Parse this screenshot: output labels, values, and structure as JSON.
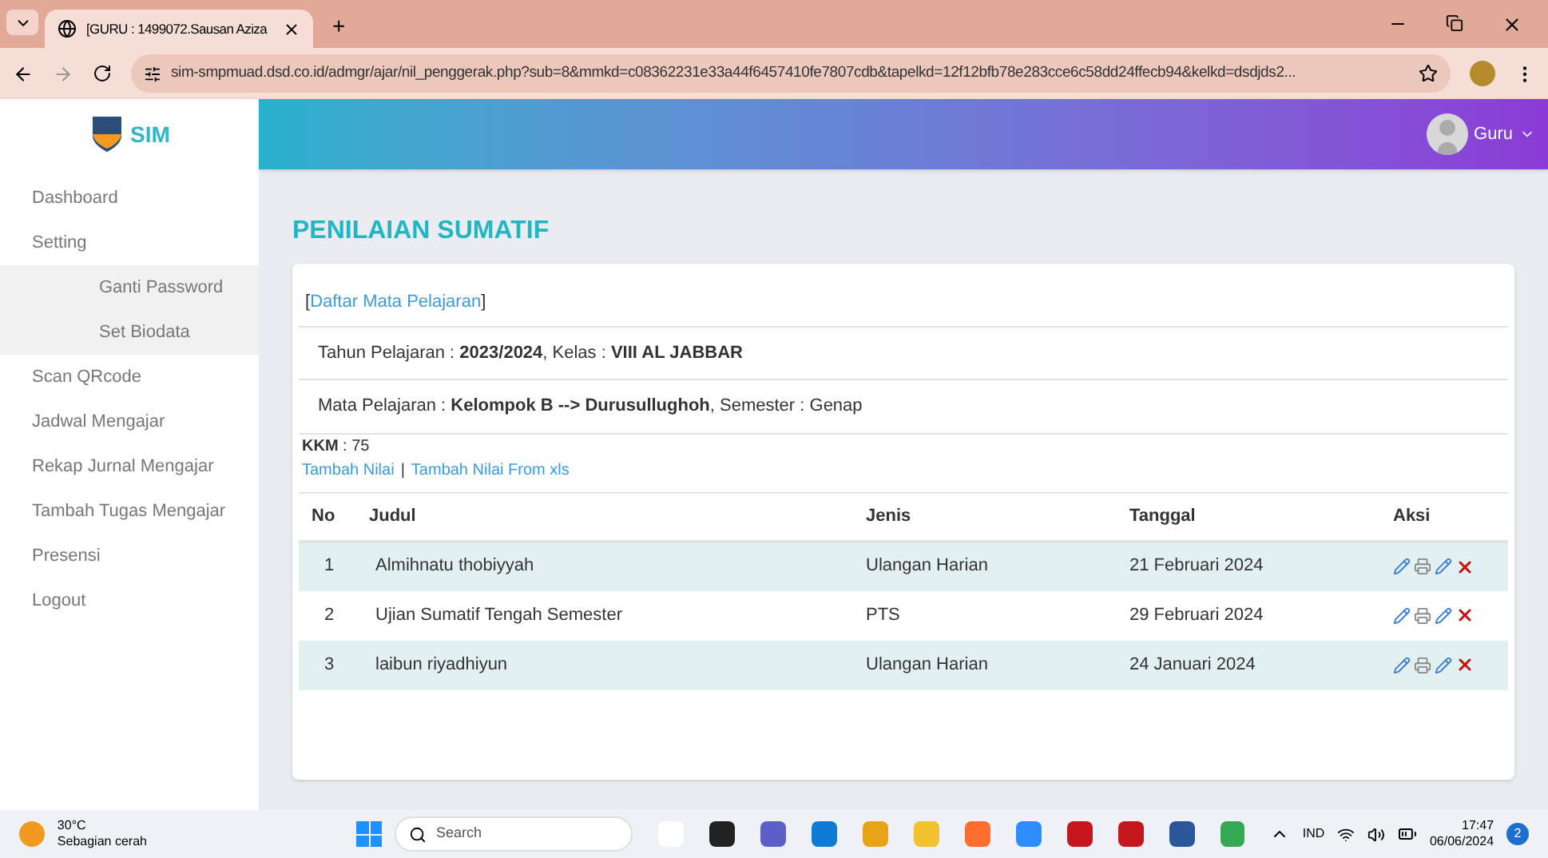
{
  "browser": {
    "tab_title": "[GURU : 1499072.Sausan Aziza",
    "new_tab": "+",
    "url": "sim-smpmuad.dsd.co.id/admgr/ajar/nil_penggerak.php?sub=8&mmkd=c08362231e33a44f6457410fe7807cdb&tapelkd=12f12bfb78e283cce6c58dd24ffecb94&kelkd=dsdjds2..."
  },
  "app": {
    "logo_text": "SIM",
    "user_name": "Guru"
  },
  "sidebar": {
    "items": [
      {
        "label": "Dashboard"
      },
      {
        "label": "Setting",
        "expanded": true,
        "children": [
          {
            "label": "Ganti Password"
          },
          {
            "label": "Set Biodata"
          }
        ]
      },
      {
        "label": "Scan QRcode"
      },
      {
        "label": "Jadwal Mengajar"
      },
      {
        "label": "Rekap Jurnal Mengajar"
      },
      {
        "label": "Tambah Tugas Mengajar"
      },
      {
        "label": "Presensi"
      },
      {
        "label": "Logout"
      }
    ]
  },
  "page": {
    "title": "PENILAIAN SUMATIF",
    "back_link": {
      "open": "[",
      "label": "Daftar Mata Pelajaran",
      "close": "]"
    },
    "info_lines": [
      "Tahun Pelajaran : **2023/2024**, Kelas : **VIII AL JABBAR**",
      "Mata Pelajaran : **Kelompok B --> Durusullughoh**, Semester : Genap"
    ],
    "kkm": "**KKM** : 75",
    "actions": [
      "Tambah Nilai",
      "Tambah Nilai From xls"
    ],
    "action_separator": "|",
    "table": {
      "columns": [
        "No",
        "Judul",
        "Jenis",
        "Tanggal",
        "Aksi"
      ],
      "rows": [
        {
          "no": "1",
          "judul": "Almihnatu thobiyyah",
          "jenis": "Ulangan Harian",
          "tanggal": "21 Februari 2024"
        },
        {
          "no": "2",
          "judul": "Ujian Sumatif Tengah Semester",
          "jenis": "PTS",
          "tanggal": "29 Februari 2024"
        },
        {
          "no": "3",
          "judul": "laibun riyadhiyun",
          "jenis": "Ulangan Harian",
          "tanggal": "24 Januari 2024"
        }
      ]
    }
  },
  "taskbar": {
    "temperature": "30°C",
    "weather": "Sebagian cerah",
    "search_placeholder": "Search",
    "language": "IND",
    "time": "17:47",
    "date": "06/06/2024",
    "notifications": "2"
  }
}
